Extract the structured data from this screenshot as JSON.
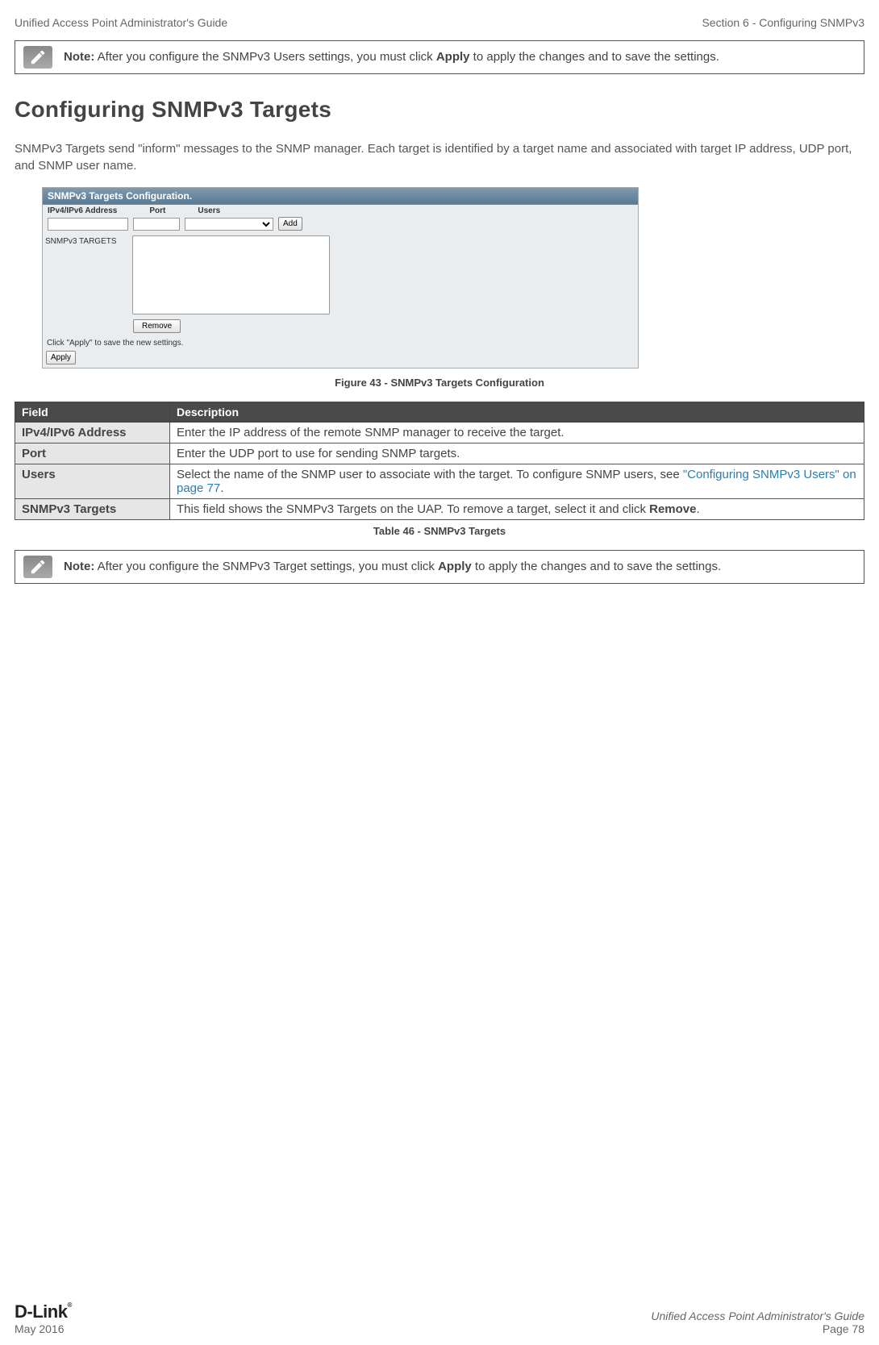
{
  "header": {
    "left": "Unified Access Point Administrator's Guide",
    "right": "Section 6 - Configuring SNMPv3"
  },
  "note1": {
    "prefix": "Note:",
    "body_a": " After you configure the SNMPv3 Users settings, you must click ",
    "bold": "Apply",
    "body_b": " to apply the changes and to save the settings."
  },
  "title": "Configuring SNMPv3 Targets",
  "intro": "SNMPv3 Targets send \"inform\" messages to the SNMP manager. Each target is identified by a target name and associated with target IP address, UDP port, and SNMP user name.",
  "shot": {
    "title": "SNMPv3 Targets Configuration.",
    "col1": "IPv4/IPv6 Address",
    "col2": "Port",
    "col3": "Users",
    "add": "Add",
    "side": "SNMPv3 TARGETS",
    "remove": "Remove",
    "help": "Click \"Apply\" to save the new settings.",
    "apply": "Apply"
  },
  "figcap": "Figure 43 - SNMPv3 Targets Configuration",
  "thead": {
    "c1": "Field",
    "c2": "Description"
  },
  "rows": {
    "r1f": "IPv4/IPv6 Address",
    "r1d": "Enter the IP address of the remote SNMP manager to receive the target.",
    "r2f": "Port",
    "r2d": "Enter the UDP port to use for sending SNMP targets.",
    "r3f": "Users",
    "r3d_a": "Select the name of the SNMP user to associate with the target. To configure SNMP users, see ",
    "r3d_link": "\"Configuring SNMPv3 Users\" on page 77",
    "r3d_b": ".",
    "r4f": "SNMPv3 Targets",
    "r4d_a": "This field shows the SNMPv3 Targets on the UAP. To remove a target, select it and click ",
    "r4d_bold": "Remove",
    "r4d_b": "."
  },
  "tabcap": "Table 46 - SNMPv3 Targets",
  "note2": {
    "prefix": "Note:",
    "body_a": " After you configure the SNMPv3 Target settings, you must click ",
    "bold": "Apply",
    "body_b": " to apply the changes and to save the settings."
  },
  "footer": {
    "brand": "D-Link",
    "date": "May 2016",
    "rtitle": "Unified Access Point Administrator's Guide",
    "page": "Page 78"
  }
}
